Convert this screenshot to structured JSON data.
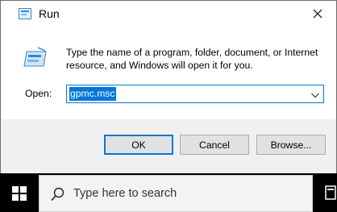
{
  "window": {
    "title": "Run",
    "description": "Type the name of a program, folder, document, or Internet resource, and Windows will open it for you.",
    "open_label": "Open:",
    "open_value": "gpmc.msc",
    "buttons": {
      "ok": "OK",
      "cancel": "Cancel",
      "browse": "Browse..."
    }
  },
  "taskbar": {
    "search_placeholder": "Type here to search"
  },
  "colors": {
    "accent": "#0078d7",
    "footer": "#f0f0f0",
    "button": "#e1e1e1",
    "taskbar": "#000000"
  },
  "icons": [
    "run-app-icon",
    "close-icon",
    "run-large-icon",
    "chevron-down-icon",
    "windows-start-icon",
    "search-icon",
    "taskbar-app-icon"
  ]
}
